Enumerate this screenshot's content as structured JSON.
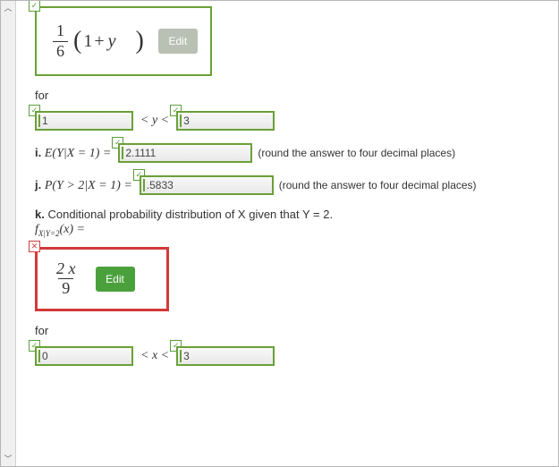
{
  "formula_box_1": {
    "frac_num": "1",
    "frac_den": "6",
    "expr_left_paren": "(",
    "expr_1": "1",
    "expr_plus": "+",
    "expr_y": "y",
    "expr_right_paren": ")",
    "edit_label": "Edit"
  },
  "for_label_1": "for",
  "range_y": {
    "low": "1",
    "mid": "< y <",
    "high": "3"
  },
  "q_i": {
    "bullet": "i.",
    "lhs_E": "E",
    "lhs_inner": "(Y|X = 1) =",
    "value": "2.1111",
    "hint": "(round the answer to four decimal places)"
  },
  "q_j": {
    "bullet": "j.",
    "lhs": "P(Y > 2|X = 1) =",
    "value": ".5833",
    "hint": "(round the answer to four decimal places)"
  },
  "q_k": {
    "bullet": "k.",
    "text": "Conditional probability distribution of X given that Y = 2.",
    "fn_label_html": "f_{X|Y=2}(x) ="
  },
  "formula_box_2": {
    "frac_num": "2 x",
    "frac_den": "9",
    "edit_label": "Edit"
  },
  "for_label_2": "for",
  "range_x": {
    "low": "0",
    "mid": "< x <",
    "high": "3"
  }
}
